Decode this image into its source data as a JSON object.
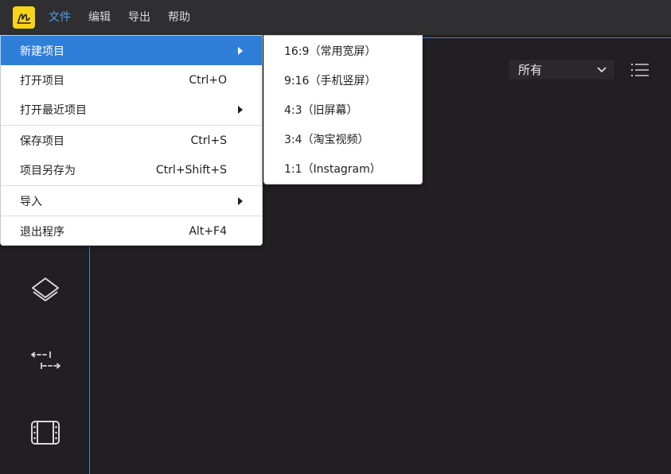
{
  "menubar": {
    "menus": [
      {
        "label": "文件"
      },
      {
        "label": "编辑"
      },
      {
        "label": "导出"
      },
      {
        "label": "帮助"
      }
    ]
  },
  "file_menu": {
    "items": [
      {
        "label": "新建项目",
        "shortcut": "",
        "has_submenu": true,
        "highlighted": true
      },
      {
        "label": "打开项目",
        "shortcut": "Ctrl+O"
      },
      {
        "label": "打开最近项目",
        "shortcut": "",
        "has_submenu": true
      },
      {
        "label": "保存项目",
        "shortcut": "Ctrl+S"
      },
      {
        "label": "项目另存为",
        "shortcut": "Ctrl+Shift+S"
      },
      {
        "label": "导入",
        "shortcut": "",
        "has_submenu": true
      },
      {
        "label": "退出程序",
        "shortcut": "Alt+F4"
      }
    ]
  },
  "new_project_submenu": {
    "items": [
      {
        "label": "16:9（常用宽屏）"
      },
      {
        "label": "9:16（手机竖屏）"
      },
      {
        "label": "4:3（旧屏幕）"
      },
      {
        "label": "3:4（淘宝视频）"
      },
      {
        "label": "1:1（Instagram）"
      }
    ]
  },
  "filter": {
    "selected": "所有"
  },
  "colors": {
    "accent": "#2f7fd8",
    "logo": "#f8d31a",
    "active_menu": "#4aa3f0",
    "background": "#211f22"
  },
  "icons": {
    "logo": "app-logo-icon",
    "rail": [
      "layers-icon",
      "transition-arrows-icon",
      "film-icon"
    ],
    "list_view": "list-view-icon"
  }
}
